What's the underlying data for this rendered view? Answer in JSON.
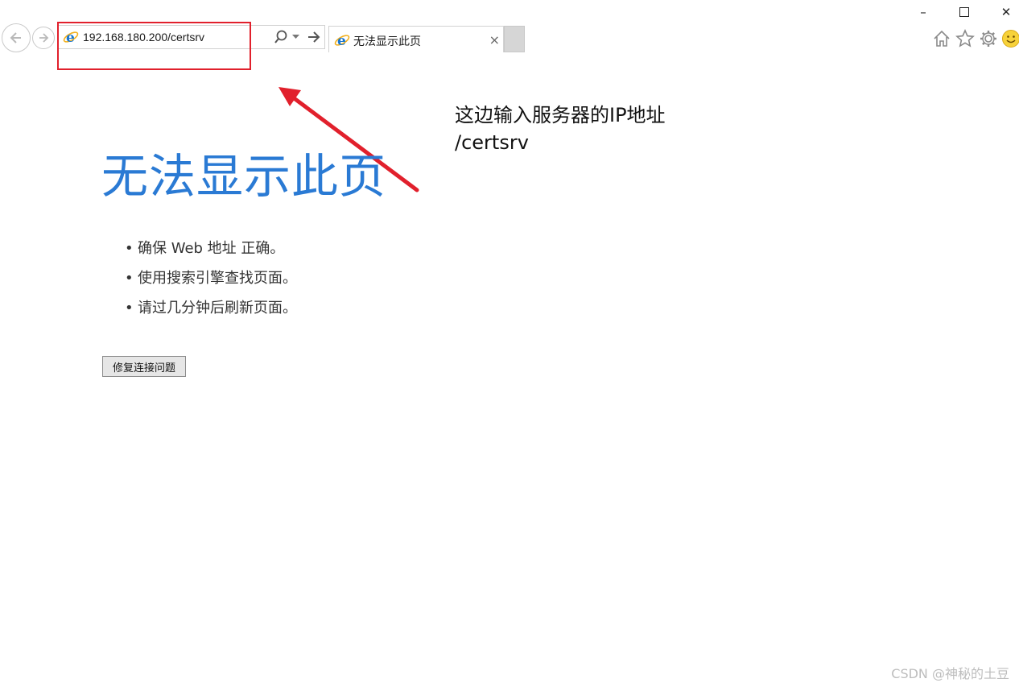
{
  "window": {
    "minimize_glyph": "–",
    "close_glyph": "✕"
  },
  "address_bar": {
    "url": "192.168.180.200/certsrv"
  },
  "tab": {
    "title": "无法显示此页",
    "close_glyph": "×"
  },
  "annotation": {
    "line1": "这边输入服务器的IP地址",
    "line2": "/certsrv",
    "color": "#e1202c"
  },
  "page": {
    "title": "无法显示此页",
    "title_color": "#2a7ad4",
    "suggestions": [
      "确保 Web 地址 正确。",
      "使用搜索引擎查找页面。",
      "请过几分钟后刷新页面。"
    ],
    "fix_button_label": "修复连接问题"
  },
  "watermark": "CSDN @神秘的土豆"
}
